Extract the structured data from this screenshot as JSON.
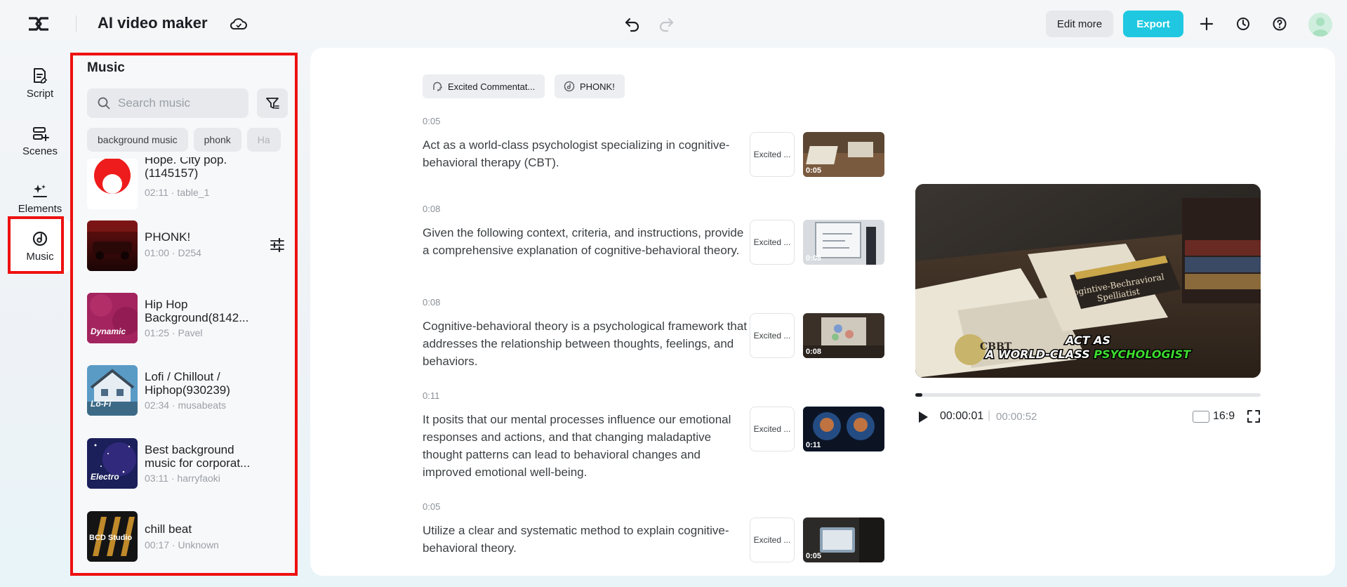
{
  "header": {
    "title": "AI video maker",
    "edit_more": "Edit more",
    "export": "Export"
  },
  "rail": {
    "items": [
      {
        "label": "Script",
        "icon": "script-icon"
      },
      {
        "label": "Scenes",
        "icon": "scenes-icon"
      },
      {
        "label": "Elements",
        "icon": "elements-icon"
      },
      {
        "label": "Music",
        "icon": "music-icon",
        "active": true
      }
    ]
  },
  "music": {
    "title": "Music",
    "search_placeholder": "Search music",
    "tags": [
      "background music",
      "phonk",
      "Ha"
    ],
    "tracks": [
      {
        "name": "Hope. City pop. (1145157)",
        "name_visible": "Hope. City pop.\n(1145157)",
        "meta": "02:11 · table_1"
      },
      {
        "name": "PHONK!",
        "meta": "01:00 · D254"
      },
      {
        "name": "Hip Hop Background(8142...",
        "meta": "01:25 · Pavel",
        "overlay": "Dynamic"
      },
      {
        "name": "Lofi / Chillout / Hiphop(930239)",
        "meta": "02:34 · musabeats",
        "overlay": "Lo-Fi"
      },
      {
        "name": "Best background music for corporat...",
        "meta": "03:11 · harryfaoki",
        "overlay": "Electro"
      },
      {
        "name": "chill beat",
        "meta": "00:17 · Unknown",
        "overlay": "BCD Studio"
      }
    ]
  },
  "main": {
    "voice_chip": "Excited Commentat...",
    "music_chip": "PHONK!",
    "scenes": [
      {
        "duration": "0:05",
        "text": "Act as a world-class psychologist specializing in cognitive-behavioral therapy (CBT).",
        "voice": "Excited ...",
        "thumb_time": "0:05"
      },
      {
        "duration": "0:08",
        "text": "Given the following context, criteria, and instructions, provide a comprehensive explanation of cognitive-behavioral theory.",
        "voice": "Excited ...",
        "thumb_time": "0:08"
      },
      {
        "duration": "0:08",
        "text": "Cognitive-behavioral theory is a psychological framework that addresses the relationship between thoughts, feelings, and behaviors.",
        "voice": "Excited ...",
        "thumb_time": "0:08"
      },
      {
        "duration": "0:11",
        "text": "It posits that our mental processes influence our emotional responses and actions, and that changing maladaptive thought patterns can lead to behavioral changes and improved emotional well-being.",
        "voice": "Excited ...",
        "thumb_time": "0:11"
      },
      {
        "duration": "0:05",
        "text": "Utilize a clear and systematic method to explain cognitive-behavioral theory.",
        "voice": "Excited ...",
        "thumb_time": "0:05"
      }
    ]
  },
  "preview": {
    "caption_line1": "ACT AS",
    "caption_line2a": "A WORLD-CLASS ",
    "caption_line2b": "PSYCHOLOGIST",
    "nameplate_line1": "Cogintive-Bechravioral",
    "nameplate_line2": "Spelliatist",
    "doc_text": "CBBT",
    "progress": 0.02,
    "time_current": "00:00:01",
    "time_separator": "|",
    "time_total": "00:00:52",
    "ratio": "16:9"
  },
  "colors": {
    "accent": "#1fc8e0",
    "highlight_border": "#ee1111",
    "caption_green": "#3ddc2f"
  }
}
